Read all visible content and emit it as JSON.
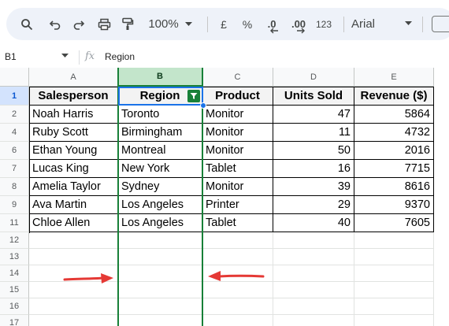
{
  "toolbar": {
    "zoom": "100%",
    "currency": "£",
    "percent": "%",
    "dec_decrease": ".0",
    "dec_increase": ".00",
    "number_format": "123",
    "font": "Arial"
  },
  "formula_bar": {
    "cell_ref": "B1",
    "fx": "fx",
    "content": "Region"
  },
  "columns": [
    "A",
    "B",
    "C",
    "D",
    "E"
  ],
  "selected_column": "B",
  "row_numbers": [
    "1",
    "2",
    "4",
    "6",
    "7",
    "8",
    "9",
    "11",
    "12",
    "13",
    "14",
    "15",
    "16",
    "17"
  ],
  "table": {
    "headers": [
      "Salesperson",
      "Region",
      "Product",
      "Units Sold",
      "Revenue ($)"
    ],
    "rows": [
      [
        "Noah Harris",
        "Toronto",
        "Monitor",
        "47",
        "5864"
      ],
      [
        "Ruby Scott",
        "Birmingham",
        "Monitor",
        "11",
        "4732"
      ],
      [
        "Ethan Young",
        "Montreal",
        "Monitor",
        "50",
        "2016"
      ],
      [
        "Lucas King",
        "New York",
        "Tablet",
        "16",
        "7715"
      ],
      [
        "Amelia Taylor",
        "Sydney",
        "Monitor",
        "39",
        "8616"
      ],
      [
        "Ava Martin",
        "Los Angeles",
        "Printer",
        "29",
        "9370"
      ],
      [
        "Chloe Allen",
        "Los Angeles",
        "Tablet",
        "40",
        "7605"
      ]
    ]
  },
  "colors": {
    "filter_green": "#188038",
    "selection_blue": "#1a73e8",
    "arrow_red": "#e53935"
  }
}
